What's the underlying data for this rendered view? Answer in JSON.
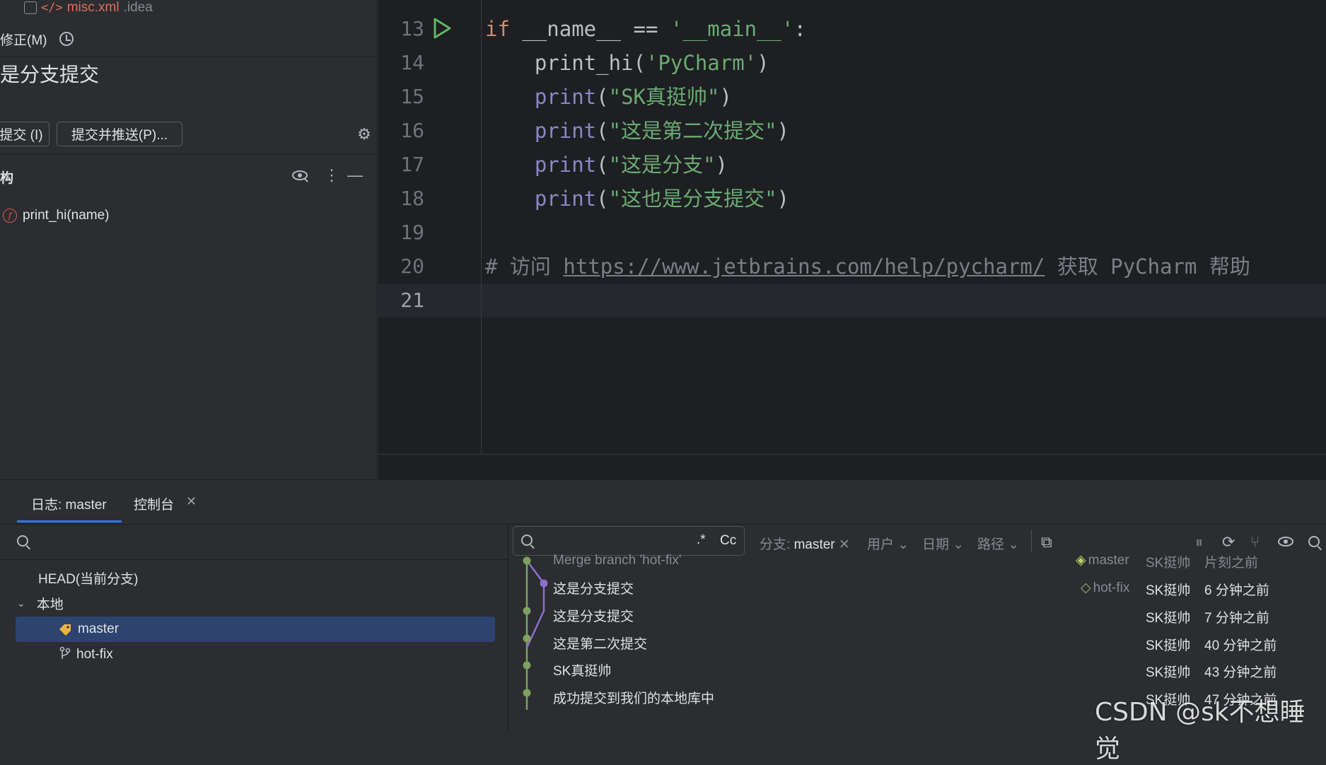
{
  "left_panel": {
    "file_name": "misc.xml",
    "file_dir": ".idea",
    "amend_label": "修正(M)",
    "commit_message": "是分支提交",
    "commit_button": "提交 (I)",
    "commit_push_button": "提交并推送(P)...",
    "structure_title": "构",
    "structure_item": "print_hi(name)"
  },
  "editor": {
    "lines": [
      {
        "num": "13",
        "current": false
      },
      {
        "num": "14",
        "current": false
      },
      {
        "num": "15",
        "current": false
      },
      {
        "num": "16",
        "current": false
      },
      {
        "num": "17",
        "current": false
      },
      {
        "num": "18",
        "current": false
      },
      {
        "num": "19",
        "current": false
      },
      {
        "num": "20",
        "current": false
      },
      {
        "num": "21",
        "current": true
      }
    ],
    "code": {
      "l13_kw": "if",
      "l13_a": " __name__ == ",
      "l13_str": "'__main__'",
      "l13_b": ":",
      "l14_fn": "    print_hi(",
      "l14_str": "'PyCharm'",
      "l14_end": ")",
      "l15_bi": "    print",
      "l15_a": "(",
      "l15_str": "\"SK真挺帅\"",
      "l15_end": ")",
      "l16_bi": "    print",
      "l16_a": "(",
      "l16_str": "\"这是第二次提交\"",
      "l16_end": ")",
      "l17_bi": "    print",
      "l17_a": "(",
      "l17_str": "\"这是分支\"",
      "l17_end": ")",
      "l18_bi": "    print",
      "l18_a": "(",
      "l18_str": "\"这也是分支提交\"",
      "l18_end": ")",
      "l20_a": "# 访问 ",
      "l20_link": "https://www.jetbrains.com/help/pycharm/",
      "l20_b": " 获取 PyCharm 帮助"
    }
  },
  "bottom": {
    "tabs": [
      {
        "label": "日志: master",
        "active": true
      },
      {
        "label": "控制台",
        "active": false
      }
    ],
    "branches": {
      "head": "HEAD(当前分支)",
      "local": "本地",
      "items": [
        {
          "label": "master",
          "selected": true
        },
        {
          "label": "hot-fix",
          "selected": false
        }
      ]
    },
    "filters": {
      "branch_label": "分支: ",
      "branch_value": "master",
      "user": "用户",
      "date": "日期",
      "path": "路径",
      "regex": ".*",
      "case": "Cc"
    },
    "commits": [
      {
        "message": "Merge branch 'hot-fix'",
        "ref": "master",
        "author": "SK挺帅",
        "date": "片刻之前",
        "dim": true
      },
      {
        "message": "这是分支提交",
        "ref": "hot-fix",
        "author": "SK挺帅",
        "date": "6 分钟之前",
        "dim": false
      },
      {
        "message": "这是分支提交",
        "ref": "",
        "author": "SK挺帅",
        "date": "7 分钟之前",
        "dim": false
      },
      {
        "message": "这是第二次提交",
        "ref": "",
        "author": "SK挺帅",
        "date": "40 分钟之前",
        "dim": false
      },
      {
        "message": "SK真挺帅",
        "ref": "",
        "author": "SK挺帅",
        "date": "43 分钟之前",
        "dim": false
      },
      {
        "message": "成功提交到我们的本地库中",
        "ref": "",
        "author": "SK挺帅",
        "date": "47 分钟之前",
        "dim": false
      }
    ],
    "colors": {
      "graph_green": "#7fa061",
      "graph_purple": "#8b6fc9",
      "accent": "#3574f0"
    }
  },
  "watermark": "CSDN @sk不想睡觉"
}
